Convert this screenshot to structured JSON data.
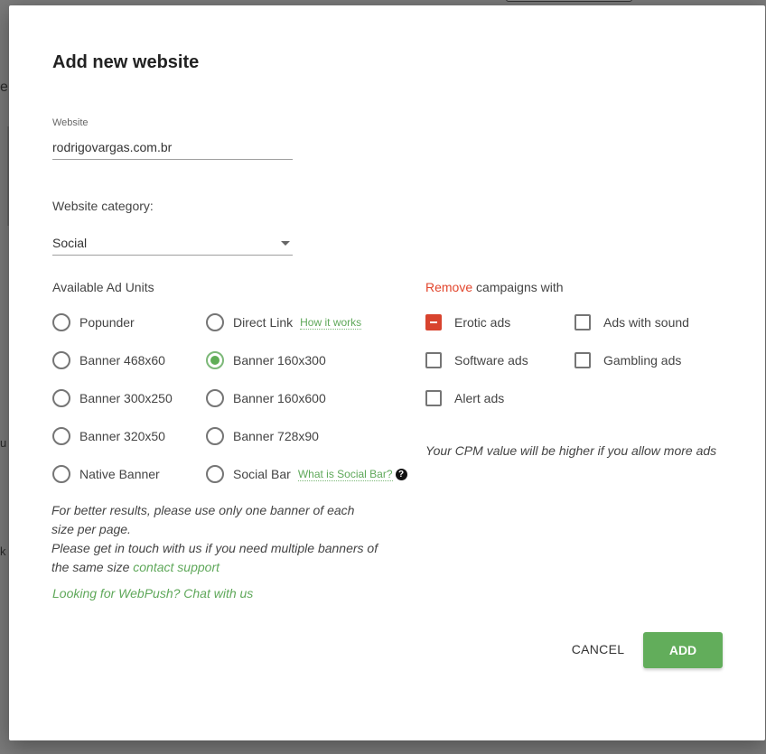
{
  "dialog": {
    "title": "Add new website",
    "website_label": "Website",
    "website_value": "rodrigovargas.com.br",
    "category_label": "Website category:",
    "category_value": "Social"
  },
  "ad_units": {
    "heading": "Available Ad Units",
    "col1": [
      {
        "label": "Popunder",
        "selected": false
      },
      {
        "label": "Banner 468x60",
        "selected": false
      },
      {
        "label": "Banner 300x250",
        "selected": false
      },
      {
        "label": "Banner 320x50",
        "selected": false
      },
      {
        "label": "Native Banner",
        "selected": false
      }
    ],
    "col2": [
      {
        "label": "Direct Link",
        "selected": false,
        "help": "How it works"
      },
      {
        "label": "Banner 160x300",
        "selected": true
      },
      {
        "label": "Banner 160x600",
        "selected": false
      },
      {
        "label": "Banner 728x90",
        "selected": false
      },
      {
        "label": "Social Bar",
        "selected": false,
        "help": "What is Social Bar?"
      }
    ],
    "help_icon": "question-circle-icon"
  },
  "remove": {
    "word": "Remove",
    "rest": " campaigns with",
    "col1": [
      {
        "label": "Erotic ads",
        "state": "indeterminate"
      },
      {
        "label": "Software ads",
        "state": "unchecked"
      },
      {
        "label": "Alert ads",
        "state": "unchecked"
      }
    ],
    "col2": [
      {
        "label": "Ads with sound",
        "state": "unchecked"
      },
      {
        "label": "Gambling ads",
        "state": "unchecked"
      }
    ],
    "cpm_note": "Your CPM value will be higher if you allow more ads"
  },
  "notes": {
    "line1": "For better results, please use only one banner of each size per page.",
    "line2": "Please get in touch with us if you need multiple banners of the same size",
    "contact_link": "contact support",
    "webpush": "Looking for WebPush? Chat with us"
  },
  "actions": {
    "cancel": "CANCEL",
    "add": "ADD"
  },
  "background": {
    "frag1": "e",
    "frag2": "u",
    "frag3": "k"
  },
  "colors": {
    "accent_green": "#62ad5b",
    "remove_red": "#e2452c",
    "overlay": "#7a7a7a"
  }
}
